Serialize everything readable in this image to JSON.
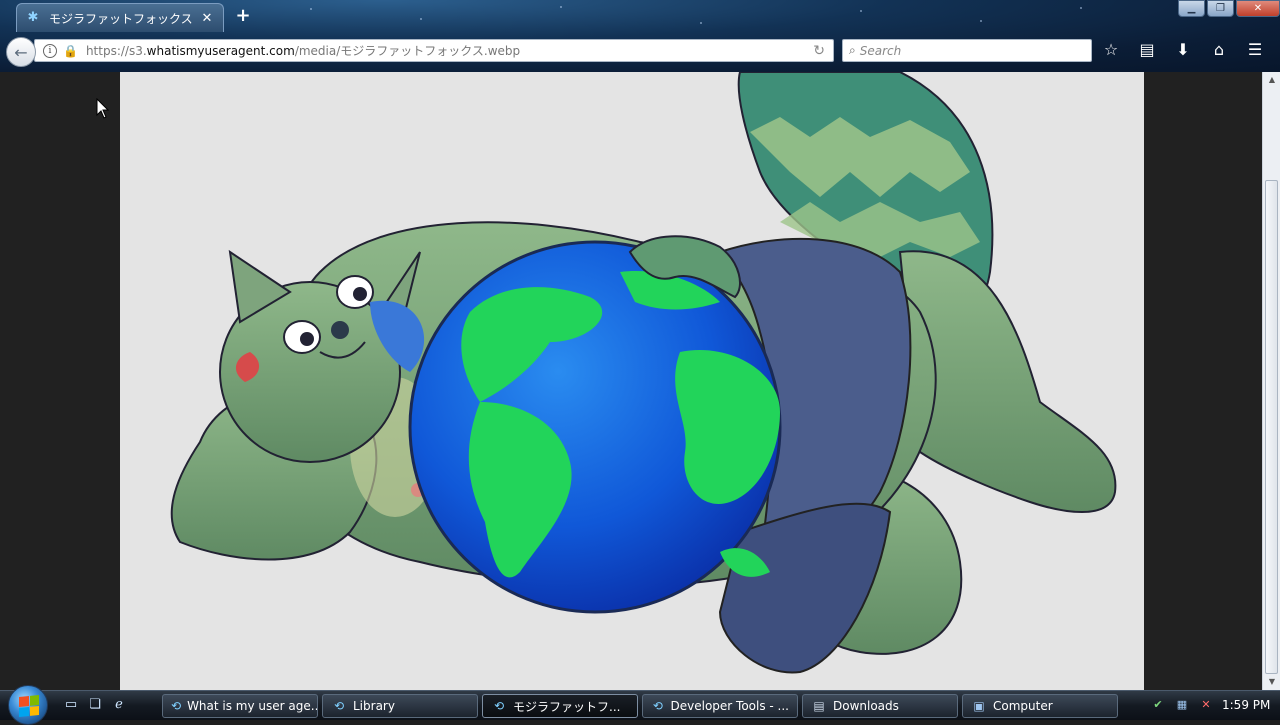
{
  "browser": {
    "tab": {
      "title": "モジラファットフォックス"
    },
    "url": {
      "prefix": "https://s3.",
      "host": "whatismyuseragent.com",
      "path": "/media/モジラファットフォックス.webp"
    },
    "search": {
      "placeholder": "Search"
    },
    "icons": [
      "star-icon",
      "reading-list-icon",
      "download-icon",
      "home-icon",
      "menu-icon"
    ]
  },
  "content": {
    "image": "illustration of a green plump fox hugging an Earth globe"
  },
  "taskbar": {
    "tasks": [
      {
        "label": "What is my user age...",
        "icon": "firefox-icon",
        "active": false
      },
      {
        "label": "Library",
        "icon": "firefox-icon",
        "active": false
      },
      {
        "label": "モジラファットフ...",
        "icon": "firefox-icon",
        "active": true
      },
      {
        "label": "Developer Tools - ...",
        "icon": "firefox-icon",
        "active": false
      },
      {
        "label": "Downloads",
        "icon": "downloads-icon",
        "active": false
      },
      {
        "label": "Computer",
        "icon": "computer-icon",
        "active": false
      }
    ],
    "clock": "1:59 PM"
  }
}
